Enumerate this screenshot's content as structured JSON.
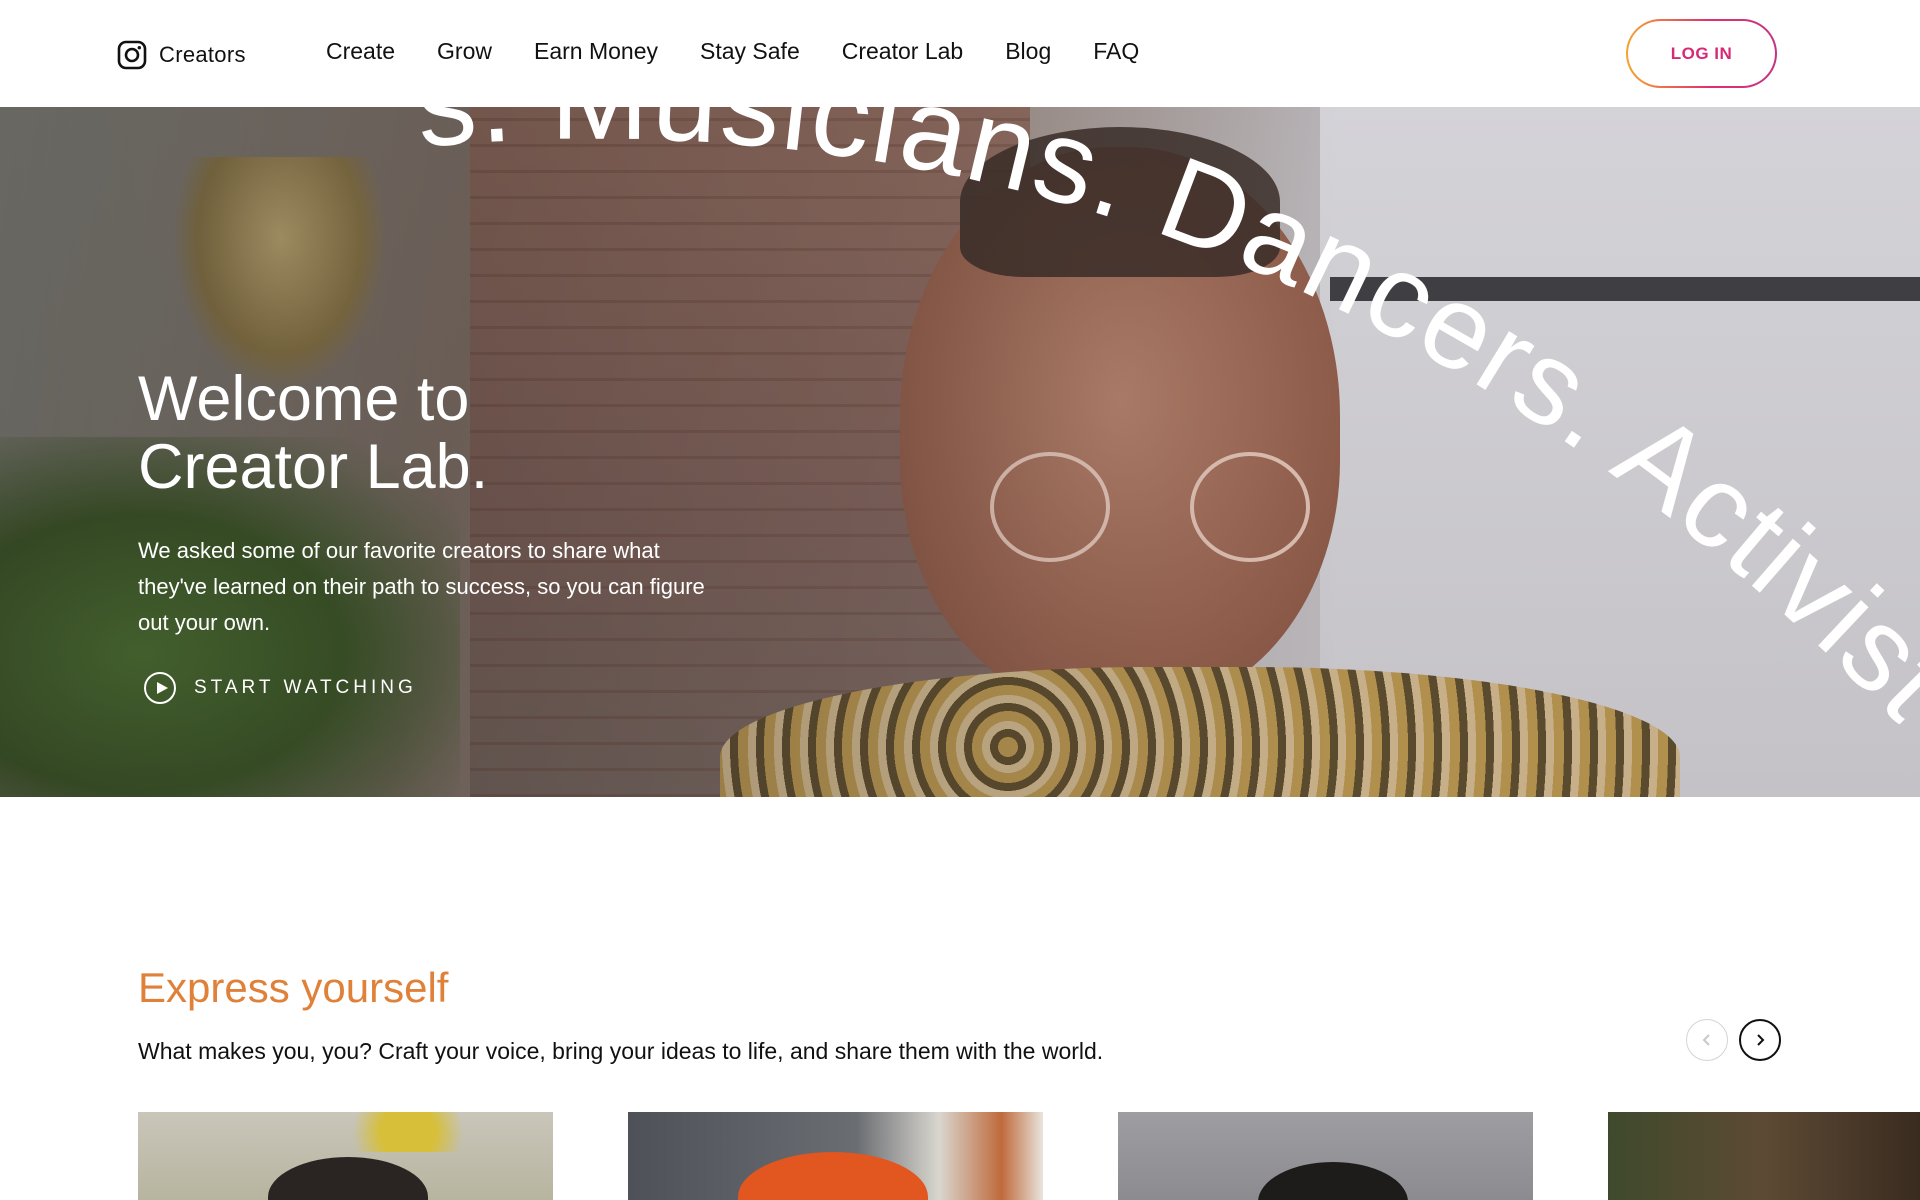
{
  "header": {
    "brand_label": "Creators",
    "nav": [
      {
        "label": "Create"
      },
      {
        "label": "Grow"
      },
      {
        "label": "Earn Money"
      },
      {
        "label": "Stay Safe"
      },
      {
        "label": "Creator Lab"
      },
      {
        "label": "Blog"
      },
      {
        "label": "FAQ"
      }
    ],
    "login_label": "LOG IN"
  },
  "hero": {
    "arc_text": "s. Musicians. Dancers. Activist",
    "title_line1": "Welcome to",
    "title_line2": "Creator Lab.",
    "description": "We asked some of our favorite creators to share what they've learned on their path to success, so you can figure out your own.",
    "start_label": "START WATCHING"
  },
  "express": {
    "title": "Express yourself",
    "description": "What makes you, you? Craft your voice, bring your ideas to life, and share them with the world."
  },
  "colors": {
    "accent_orange": "#e0813a",
    "login_pink": "#d62976"
  }
}
